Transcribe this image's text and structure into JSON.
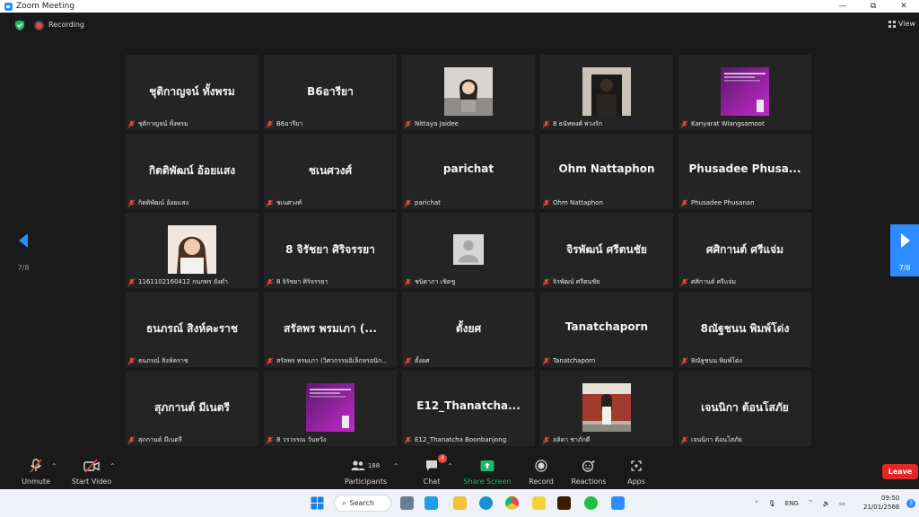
{
  "window": {
    "title": "Zoom Meeting",
    "controls": [
      "—",
      "⧉",
      "✕"
    ]
  },
  "infobar": {
    "recording": "Recording",
    "view": "View"
  },
  "participants": [
    {
      "name": "ชุติกาญจน์ ทั้งพรม",
      "label": "ชุติกาญจน์ ทั้งพรม",
      "video": "name"
    },
    {
      "name": "B6อารียา",
      "label": "B6อารียา",
      "video": "name"
    },
    {
      "name": "",
      "label": "Nittaya Jaidee",
      "video": "photo-girl"
    },
    {
      "name": "",
      "label": "8 ธนัทพงศ์ พ่วงรัก",
      "video": "photo-dark"
    },
    {
      "name": "",
      "label": "Kanyarat Wiangsamoot",
      "video": "photo-purple"
    },
    {
      "name": "กิตติพัฒน์ อ้อยแสง",
      "label": "กิตติพัฒน์ อ้อยแสง",
      "video": "name"
    },
    {
      "name": "ชเนศวงศ์",
      "label": "ชเนศวงศ์",
      "video": "name"
    },
    {
      "name": "parichat",
      "label": "parichat",
      "video": "name"
    },
    {
      "name": "Ohm Nattaphon",
      "label": "Ohm Nattaphon",
      "video": "name"
    },
    {
      "name": "Phusadee  Phusa...",
      "label": "Phusadee Phusanan",
      "video": "name"
    },
    {
      "name": "",
      "label": "1161102160412 กนกพร ยังดำ",
      "video": "photo-smile"
    },
    {
      "name": "8 จิรัชยา ศิริจรรยา",
      "label": "8 จิรัชยา ศิริจรรยา",
      "video": "name"
    },
    {
      "name": "",
      "label": "ชนิดาภา เชิดชู",
      "video": "photo-avatar"
    },
    {
      "name": "จิรพัฒน์ ศรีตนชัย",
      "label": "จิรพัฒน์ ศรีตนชัย",
      "video": "name"
    },
    {
      "name": "ศศิกานต์ ศรีแจ่ม",
      "label": "ศศิกานต์ ศรีแจ่ม",
      "video": "name"
    },
    {
      "name": "ธนภรณ์ สิงห์คะราช",
      "label": "ธนภรณ์ สิงห์คราช",
      "video": "name"
    },
    {
      "name": "สรัลพร พรมเภา (...",
      "label": "สรัลพร พรมเภา (วิศวกรรมอิเล็กทรอนิก...",
      "video": "name"
    },
    {
      "name": "ตั้งยศ",
      "label": "ตั้งยศ",
      "video": "name"
    },
    {
      "name": "Tanatchaporn",
      "label": "Tanatchaporn",
      "video": "name"
    },
    {
      "name": "8ณัฐชนน พิมพ์โด่ง",
      "label": "8ณัฐชนน พิมพ์โด่ง",
      "video": "name"
    },
    {
      "name": "สุภกานต์ มีเนตรี",
      "label": "สุภกานต์ มีเนตรี",
      "video": "name"
    },
    {
      "name": "",
      "label": "8 วรวรรณ วันหวัง",
      "video": "photo-purple"
    },
    {
      "name": "E12_Thanatcha...",
      "label": "E12_Thanatcha Boonbanjong",
      "video": "name"
    },
    {
      "name": "",
      "label": "ลลิตา ชาภักดี",
      "video": "photo-outdoor"
    },
    {
      "name": "เจนนิกา  ต้อนโสภัย",
      "label": "เจนนิกา ต้อนโสภัย",
      "video": "name"
    }
  ],
  "pagination": {
    "left": "7/8",
    "right": "7/8"
  },
  "toolbar": {
    "unmute": "Unmute",
    "start_video": "Start Video",
    "participants": "Participants",
    "participants_count": "188",
    "chat": "Chat",
    "chat_badge": "4",
    "share_screen": "Share Screen",
    "record": "Record",
    "reactions": "Reactions",
    "apps": "Apps",
    "leave": "Leave"
  },
  "taskbar": {
    "search": "Search",
    "lang": "ENG",
    "time": "09:50",
    "date": "21/01/2566",
    "notif": "3"
  },
  "colors": {
    "accent": "#2d8cff",
    "leave": "#e02828",
    "share": "#1fb86b",
    "mic_muted": "#e8483f"
  }
}
